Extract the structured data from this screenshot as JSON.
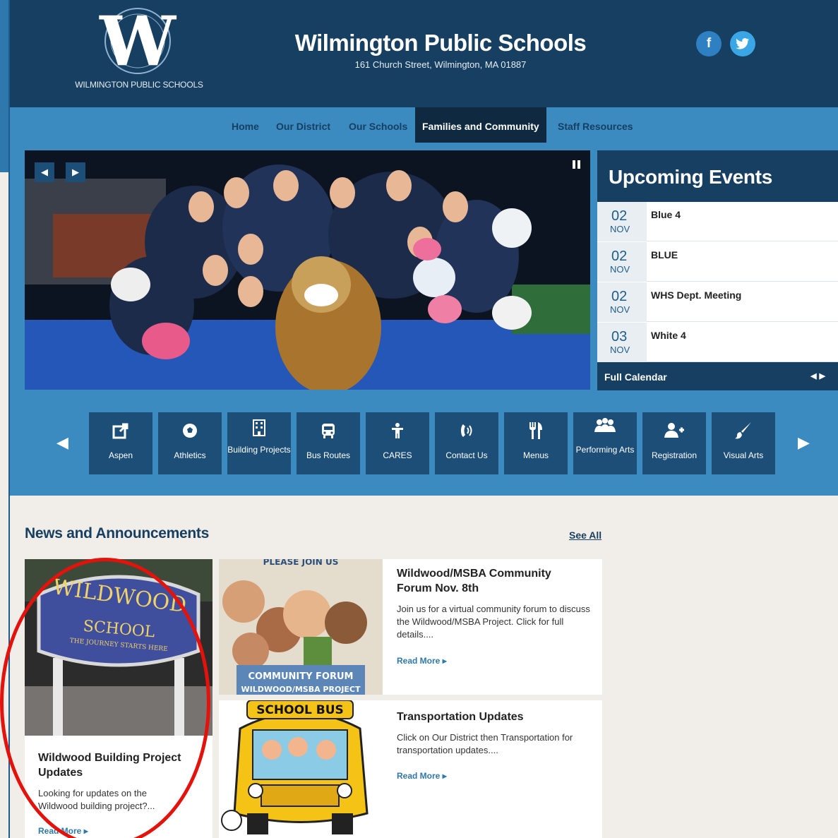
{
  "header": {
    "logo_letter": "W",
    "logo_text": "WILMINGTON PUBLIC SCHOOLS",
    "title": "Wilmington Public Schools",
    "address": "161 Church Street, Wilmington, MA 01887",
    "social": {
      "facebook": "f",
      "twitter": "t"
    },
    "colors": {
      "header_bg": "#173f61",
      "nav_bg": "#3b8bc0",
      "accent": "#1d4e78"
    }
  },
  "nav": {
    "items": [
      {
        "label": "Home"
      },
      {
        "label": "Our District"
      },
      {
        "label": "Our Schools"
      },
      {
        "label": "Families and Community",
        "active": true
      },
      {
        "label": "Staff Resources"
      }
    ]
  },
  "slideshow": {
    "prev_icon": "prev-arrow-icon",
    "next_icon": "next-arrow-icon",
    "pause_icon": "pause-icon"
  },
  "events": {
    "heading": "Upcoming Events",
    "items": [
      {
        "day": "02",
        "month": "NOV",
        "title": "Blue 4"
      },
      {
        "day": "02",
        "month": "NOV",
        "title": "BLUE"
      },
      {
        "day": "02",
        "month": "NOV",
        "title": "WHS Dept. Meeting"
      },
      {
        "day": "03",
        "month": "NOV",
        "title": "White 4"
      }
    ],
    "full_calendar": "Full Calendar"
  },
  "quick_links": [
    {
      "label": "Aspen",
      "icon": "external-link-icon"
    },
    {
      "label": "Athletics",
      "icon": "soccer-ball-icon"
    },
    {
      "label": "Building Projects",
      "icon": "building-icon"
    },
    {
      "label": "Bus Routes",
      "icon": "bus-icon"
    },
    {
      "label": "CARES",
      "icon": "person-icon"
    },
    {
      "label": "Contact Us",
      "icon": "phone-icon"
    },
    {
      "label": "Menus",
      "icon": "utensils-icon"
    },
    {
      "label": "Performing Arts",
      "icon": "group-icon"
    },
    {
      "label": "Registration",
      "icon": "add-user-icon"
    },
    {
      "label": "Visual Arts",
      "icon": "paintbrush-icon"
    }
  ],
  "news": {
    "heading": "News and Announcements",
    "see_all": "See All",
    "read_more": "Read More",
    "featured": {
      "title": "Wildwood Building Project Updates",
      "text": "Looking for updates on the Wildwood building project?...",
      "sign_line1": "WILDWOOD",
      "sign_line2": "SCHOOL",
      "sign_line3": "THE JOURNEY STARTS HERE"
    },
    "items": [
      {
        "title": "Wildwood/MSBA Community Forum Nov. 8th",
        "text": "Join us for a virtual community forum to discuss the Wildwood/MSBA Project. Click for full details....",
        "image_top": "PLEASE JOIN US",
        "image_banner1": "COMMUNITY FORUM",
        "image_banner2": "WILDWOOD/MSBA PROJECT"
      },
      {
        "title": "Transportation Updates",
        "text": "Click on Our District then Transportation for transportation updates....",
        "image_sign": "SCHOOL BUS"
      }
    ]
  }
}
